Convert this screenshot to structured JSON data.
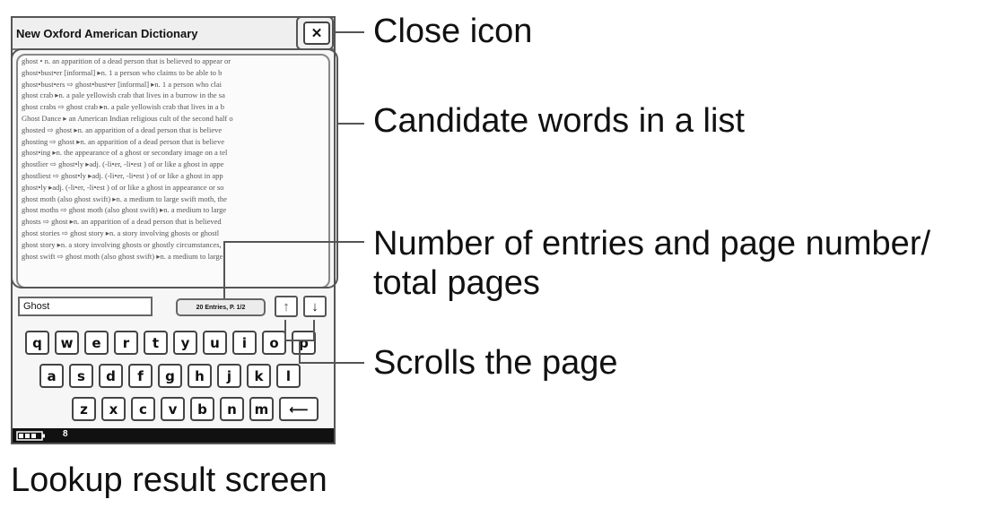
{
  "device": {
    "title": "New Oxford American Dictionary",
    "close_symbol": "✕",
    "search_value": "Ghost",
    "entries_label": "20 Entries, P. 1/2",
    "up_arrow": "↑",
    "down_arrow": "↓",
    "entries": [
      "ghost • n.  an apparition of a dead person that is believed to appear or",
      "ghost•bust•er  [informal] ▸n. 1 a person who claims to be able to b",
      "ghost•bust•ers ⇨ ghost•bust•er  [informal] ▸n. 1 a person who clai",
      "ghost crab ▸n.  a pale yellowish crab that lives in a burrow in the sa",
      "ghost crabs ⇨ ghost crab ▸n.  a pale yellowish crab that lives in a b",
      "Ghost Dance ▸ an American Indian religious cult of the second half o",
      "ghosted ⇨ ghost ▸n.  an apparition of a dead person that is believe",
      "ghosting ⇨ ghost ▸n.  an apparition of a dead person that is believe",
      "ghost•ing ▸n.  the appearance of a ghost or secondary image on a tel",
      "ghostlier ⇨ ghost•ly ▸adj. (-li•er, -li•est ) of or like a ghost in appe",
      "ghostliest ⇨ ghost•ly ▸adj. (-li•er, -li•est ) of or like a ghost in app",
      "ghost•ly ▸adj. (-li•er, -li•est ) of or like a ghost in appearance or so",
      "ghost moth (also ghost swift) ▸n.  a medium to large swift moth, the",
      "ghost moths ⇨ ghost moth (also ghost swift) ▸n.  a medium to large",
      "ghosts ⇨ ghost ▸n.  an apparition of a dead person that is believed",
      "ghost stories ⇨ ghost story ▸n.  a story involving ghosts or ghostl",
      "ghost story ▸n.  a story involving ghosts or ghostly circumstances,",
      "ghost swift ⇨ ghost moth (also ghost swift) ▸n.  a medium to large"
    ],
    "keyboard": {
      "row1": [
        "q",
        "w",
        "e",
        "r",
        "t",
        "y",
        "u",
        "i",
        "o",
        "p"
      ],
      "row2": [
        "a",
        "s",
        "d",
        "f",
        "g",
        "h",
        "j",
        "k",
        "l"
      ],
      "row3": [
        "z",
        "x",
        "c",
        "v",
        "b",
        "n",
        "m"
      ],
      "backspace": "⟵"
    },
    "page_indicator": "8"
  },
  "callouts": {
    "close_icon": "Close icon",
    "candidate_words": "Candidate words in a list",
    "entries_page_line1": "Number of entries and page number/",
    "entries_page_line2": "total pages",
    "scrolls": "Scrolls the page"
  },
  "caption": "Lookup result screen"
}
